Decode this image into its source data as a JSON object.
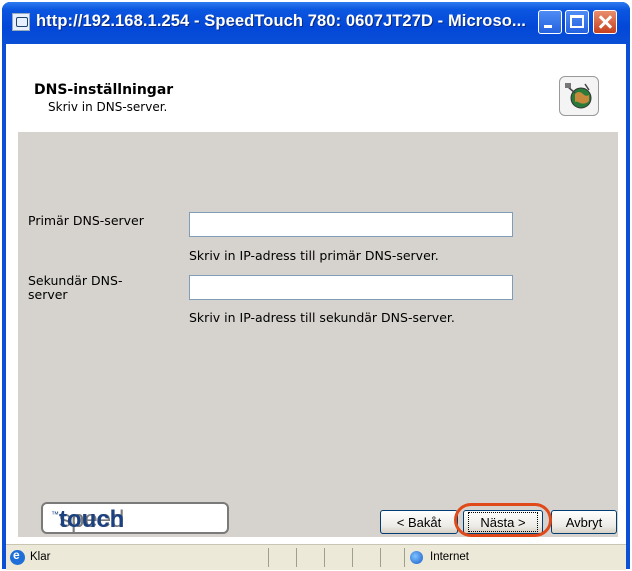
{
  "window": {
    "title": "http://192.168.1.254 - SpeedTouch 780:  0607JT27D - Microso..."
  },
  "header": {
    "title": "DNS-inställningar",
    "subtitle": "Skriv in DNS-server.",
    "icon": "globe-network-icon"
  },
  "form": {
    "primary": {
      "label": "Primär DNS-server",
      "value": "",
      "hint": "Skriv in IP-adress till primär DNS-server."
    },
    "secondary": {
      "label_line1": "Sekundär DNS-",
      "label_line2": "server",
      "value": "",
      "hint": "Skriv in IP-adress till sekundär DNS-server."
    }
  },
  "footer": {
    "logo_light": "speed",
    "logo_bold": "touch",
    "logo_tm": "™",
    "back_label": "< Bakåt",
    "next_label": "Nästa >",
    "cancel_label": "Avbryt",
    "highlight_color": "#e04a1a"
  },
  "statusbar": {
    "status": "Klar",
    "zone": "Internet"
  }
}
